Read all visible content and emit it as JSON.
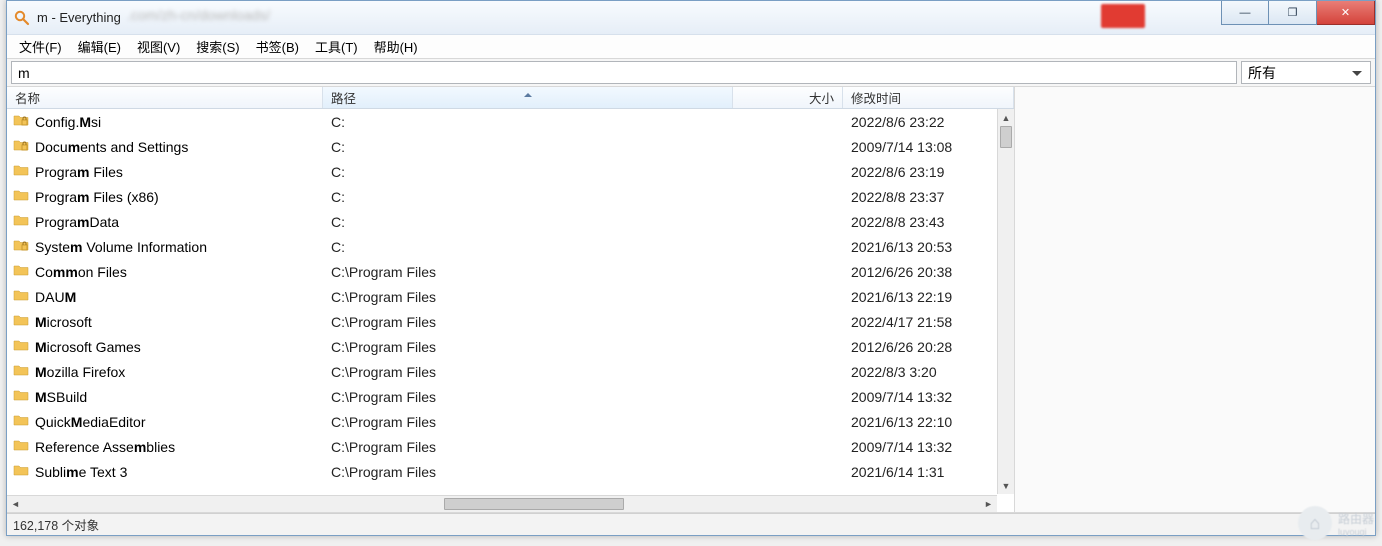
{
  "window": {
    "title": "m - Everything",
    "blur_text": ".com/zh-cn/downloads/",
    "controls": {
      "min": "—",
      "max": "❐",
      "close": "✕"
    }
  },
  "menu": {
    "items": [
      "文件(F)",
      "编辑(E)",
      "视图(V)",
      "搜索(S)",
      "书签(B)",
      "工具(T)",
      "帮助(H)"
    ]
  },
  "search": {
    "value": "m",
    "filter": "所有"
  },
  "columns": {
    "name": "名称",
    "path": "路径",
    "size": "大小",
    "date": "修改时间",
    "sort": "path"
  },
  "rows": [
    {
      "icon": "locked",
      "name_pre": "Config.",
      "name_hl": "M",
      "name_post": "si",
      "path": "C:",
      "size": "",
      "date": "2022/8/6 23:22"
    },
    {
      "icon": "locked",
      "name_pre": "Docu",
      "name_hl": "m",
      "name_post": "ents and Settings",
      "path": "C:",
      "size": "",
      "date": "2009/7/14 13:08"
    },
    {
      "icon": "folder",
      "name_pre": "Progra",
      "name_hl": "m",
      "name_post": " Files",
      "path": "C:",
      "size": "",
      "date": "2022/8/6 23:19"
    },
    {
      "icon": "folder",
      "name_pre": "Progra",
      "name_hl": "m",
      "name_post": " Files (x86)",
      "path": "C:",
      "size": "",
      "date": "2022/8/8 23:37"
    },
    {
      "icon": "folder",
      "name_pre": "Progra",
      "name_hl": "m",
      "name_post": "Data",
      "path": "C:",
      "size": "",
      "date": "2022/8/8 23:43"
    },
    {
      "icon": "locked",
      "name_pre": "Syste",
      "name_hl": "m",
      "name_post": " Volume Information",
      "path": "C:",
      "size": "",
      "date": "2021/6/13 20:53"
    },
    {
      "icon": "folder",
      "name_pre": "Co",
      "name_hl": "mm",
      "name_post": "on Files",
      "path": "C:\\Program Files",
      "size": "",
      "date": "2012/6/26 20:38"
    },
    {
      "icon": "folder",
      "name_pre": "DAU",
      "name_hl": "M",
      "name_post": "",
      "path": "C:\\Program Files",
      "size": "",
      "date": "2021/6/13 22:19"
    },
    {
      "icon": "folder",
      "name_pre": "",
      "name_hl": "M",
      "name_post": "icrosoft",
      "path": "C:\\Program Files",
      "size": "",
      "date": "2022/4/17 21:58"
    },
    {
      "icon": "folder",
      "name_pre": "",
      "name_hl": "M",
      "name_post": "icrosoft Games",
      "path": "C:\\Program Files",
      "size": "",
      "date": "2012/6/26 20:28"
    },
    {
      "icon": "folder",
      "name_pre": "",
      "name_hl": "M",
      "name_post": "ozilla Firefox",
      "path": "C:\\Program Files",
      "size": "",
      "date": "2022/8/3 3:20"
    },
    {
      "icon": "folder",
      "name_pre": "",
      "name_hl": "M",
      "name_post": "SBuild",
      "path": "C:\\Program Files",
      "size": "",
      "date": "2009/7/14 13:32"
    },
    {
      "icon": "folder",
      "name_pre": "Quick",
      "name_hl": "M",
      "name_post": "ediaEditor",
      "path": "C:\\Program Files",
      "size": "",
      "date": "2021/6/13 22:10"
    },
    {
      "icon": "folder",
      "name_pre": "Reference Asse",
      "name_hl": "m",
      "name_post": "blies",
      "path": "C:\\Program Files",
      "size": "",
      "date": "2009/7/14 13:32"
    },
    {
      "icon": "folder",
      "name_pre": "Subli",
      "name_hl": "m",
      "name_post": "e Text 3",
      "path": "C:\\Program Files",
      "size": "",
      "date": "2021/6/14 1:31"
    }
  ],
  "status": {
    "text": "162,178 个对象"
  },
  "watermark": {
    "label": "路由器",
    "sub": "luyouqi"
  }
}
